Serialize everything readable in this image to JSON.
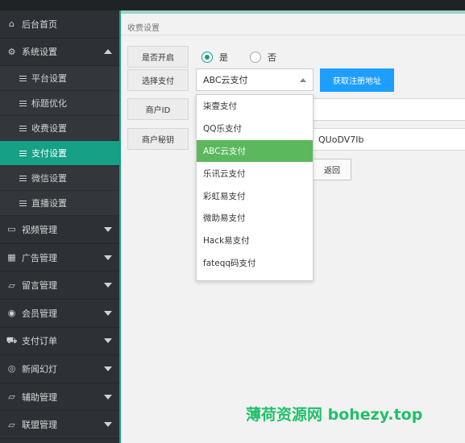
{
  "sidebar": {
    "items": [
      {
        "label": "后台首页",
        "icon": "home-icon"
      },
      {
        "label": "系统设置",
        "icon": "gear-icon"
      },
      {
        "label": "视频管理",
        "icon": "monitor-icon"
      },
      {
        "label": "广告管理",
        "icon": "grid-icon"
      },
      {
        "label": "留言管理",
        "icon": "folder-icon"
      },
      {
        "label": "会员管理",
        "icon": "user-circle-icon"
      },
      {
        "label": "支付订单",
        "icon": "cart-icon"
      },
      {
        "label": "新闻幻灯",
        "icon": "globe-icon"
      },
      {
        "label": "辅助管理",
        "icon": "folder-icon"
      },
      {
        "label": "联盟管理",
        "icon": "folder-icon"
      }
    ],
    "sub_items": [
      {
        "label": "平台设置"
      },
      {
        "label": "标题优化"
      },
      {
        "label": "收费设置"
      },
      {
        "label": "支付设置"
      },
      {
        "label": "微信设置"
      },
      {
        "label": "直播设置"
      }
    ]
  },
  "main": {
    "panel_title": "收费设置",
    "enable_label": "是否开启",
    "radio_yes": "是",
    "radio_no": "否",
    "select_label": "选择支付",
    "select_value": "ABC云支付",
    "register_button": "获取注册地址",
    "merchant_id_label": "商户ID",
    "merchant_key_label": "商户秘钥",
    "merchant_key_value": "QUoDV7Ib",
    "back_button": "返回",
    "dropdown_options": [
      {
        "label": "柒壹支付"
      },
      {
        "label": "QQ乐支付"
      },
      {
        "label": "ABC云支付"
      },
      {
        "label": "乐讯云支付"
      },
      {
        "label": "彩虹易支付"
      },
      {
        "label": "微助易支付"
      },
      {
        "label": "Hack易支付"
      },
      {
        "label": "fateqq码支付"
      }
    ]
  },
  "watermark": "薄荷资源网 bohezy.top",
  "colors": {
    "accent": "#16a085",
    "blue": "#1e9fff",
    "selected_option": "#5cb85c"
  }
}
